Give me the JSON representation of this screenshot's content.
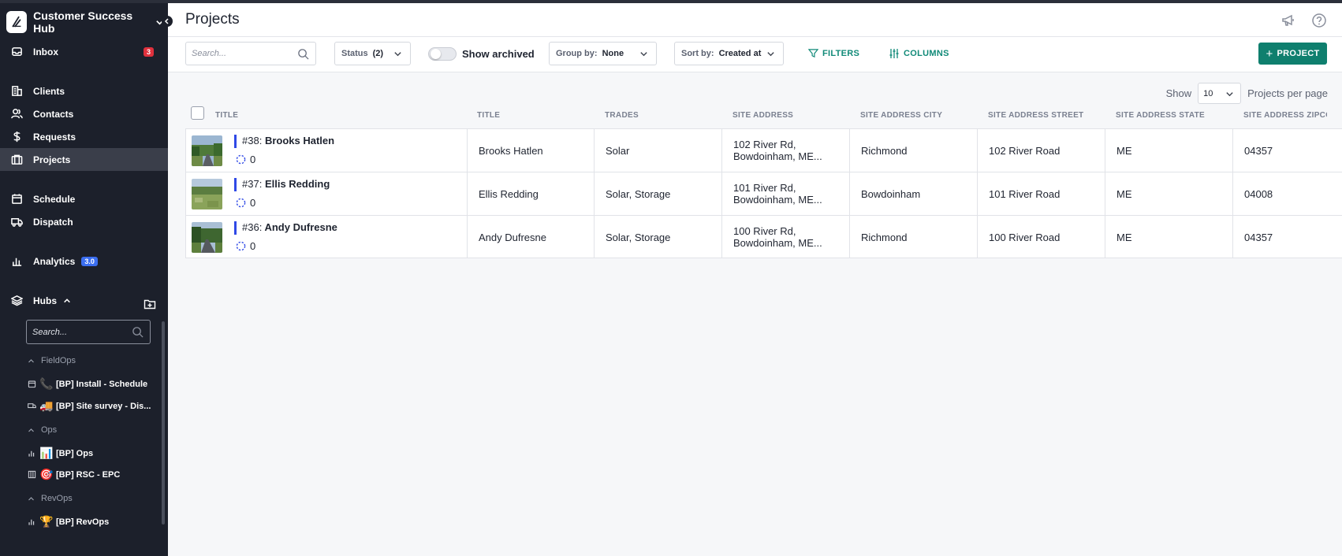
{
  "app": {
    "workspace_name": "Customer Success Hub"
  },
  "sidebar": {
    "nav": [
      {
        "label": "Inbox",
        "badge": "3",
        "icon": "inbox-icon"
      },
      {
        "label": "Clients",
        "icon": "building-icon"
      },
      {
        "label": "Contacts",
        "icon": "users-icon"
      },
      {
        "label": "Requests",
        "icon": "dollar-icon"
      },
      {
        "label": "Projects",
        "icon": "projects-icon",
        "active": true
      },
      {
        "label": "Schedule",
        "icon": "calendar-icon"
      },
      {
        "label": "Dispatch",
        "icon": "truck-icon"
      },
      {
        "label": "Analytics",
        "badge": "3.0",
        "icon": "bar-chart-icon"
      },
      {
        "label": "Hubs",
        "icon": "layers-icon"
      }
    ],
    "hubs_search_placeholder": "Search...",
    "hub_groups": [
      {
        "label": "FieldOps",
        "items": [
          {
            "label": "[BP] Install - Schedule",
            "emoji": "📞",
            "icon": "calendar-icon"
          },
          {
            "label": "[BP] Site survey - Dis...",
            "emoji": "🚚",
            "icon": "truck-icon"
          }
        ]
      },
      {
        "label": "Ops",
        "items": [
          {
            "label": "[BP] Ops",
            "emoji": "📊",
            "icon": "bar-chart-icon"
          },
          {
            "label": "[BP] RSC - EPC",
            "emoji": "🎯",
            "icon": "building-icon"
          }
        ]
      },
      {
        "label": "RevOps",
        "items": [
          {
            "label": "[BP] RevOps",
            "emoji": "🏆",
            "icon": "bar-chart-icon"
          }
        ]
      }
    ]
  },
  "header": {
    "title": "Projects"
  },
  "toolbar": {
    "search_placeholder": "Search...",
    "status_label": "Status",
    "status_value": "(2)",
    "show_archived": "Show archived",
    "group_by_label": "Group by:",
    "group_by_value": "None",
    "sort_by_label": "Sort by:",
    "sort_by_value": "Created at",
    "filters": "FILTERS",
    "columns": "COLUMNS",
    "add_project": "PROJECT"
  },
  "pager": {
    "show": "Show",
    "value": "10",
    "suffix": "Projects per page"
  },
  "table": {
    "headers": [
      "TITLE",
      "TITLE",
      "TRADES",
      "SITE ADDRESS",
      "SITE ADDRESS CITY",
      "SITE ADDRESS STREET",
      "SITE ADDRESS STATE",
      "SITE ADDRESS ZIPCODE"
    ],
    "rows": [
      {
        "num": "#38:",
        "name": "Brooks Hatlen",
        "count": "0",
        "title": "Brooks Hatlen",
        "trades": "Solar",
        "addr1": "102 River Rd,",
        "addr2": "Bowdoinham, ME...",
        "city": "Richmond",
        "street": "102 River Road",
        "state": "ME",
        "zip": "04357"
      },
      {
        "num": "#37:",
        "name": "Ellis Redding",
        "count": "0",
        "title": "Ellis Redding",
        "trades": "Solar, Storage",
        "addr1": "101 River Rd,",
        "addr2": "Bowdoinham, ME...",
        "city": "Bowdoinham",
        "street": "101 River Road",
        "state": "ME",
        "zip": "04008"
      },
      {
        "num": "#36:",
        "name": "Andy Dufresne",
        "count": "0",
        "title": "Andy Dufresne",
        "trades": "Solar, Storage",
        "addr1": "100 River Rd,",
        "addr2": "Bowdoinham, ME...",
        "city": "Richmond",
        "street": "100 River Road",
        "state": "ME",
        "zip": "04357"
      }
    ]
  },
  "colors": {
    "sidebar_bg": "#1c202b",
    "accent_teal": "#0f7f6e",
    "title_bar_blue": "#2f49e6",
    "badge_red": "#e0313d",
    "badge_blue": "#3b6ef0"
  }
}
